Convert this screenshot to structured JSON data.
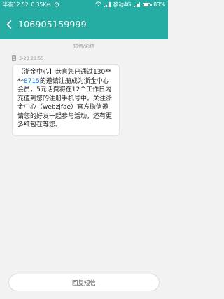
{
  "status_bar": {
    "time": "半夜12:52",
    "speed": "0.35K/s",
    "network": "移动4G",
    "battery_percent": "83%",
    "battery_level": 0.83,
    "icons": [
      "alarm-icon",
      "wifi-icon",
      "signal-icon",
      "battery-icon"
    ]
  },
  "header": {
    "title": "106905159999",
    "back_icon": "chevron-left-icon"
  },
  "conversation": {
    "section_label": "短信/彩信",
    "message": {
      "sim_label": "2",
      "time": "3-23 21:55",
      "text_part1": "【浙金中心】恭喜您已通过130****",
      "link_text": "8715",
      "text_part2": "的邀请注册成为浙金中心会员，5元话费将在12个工作日内充值到您的注册手机号中。关注浙金中心（webzjfae）官方微信邀请您的好友一起参与活动，还有更多红包在等您。"
    }
  },
  "composer": {
    "reply_label": "回复短信"
  },
  "colors": {
    "accent": "#26ada3",
    "background": "#f2f2f2",
    "link": "#1a73e8"
  }
}
